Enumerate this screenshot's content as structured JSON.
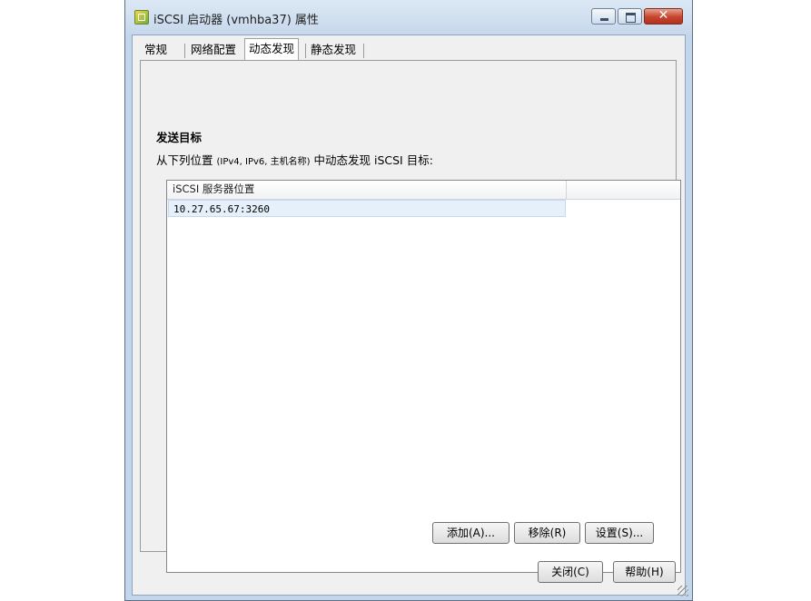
{
  "window": {
    "title": "iSCSI 启动器 (vmhba37) 属性"
  },
  "titlebar_buttons": {
    "minimize": "minimize-icon",
    "maximize": "maximize-icon",
    "close": "✕"
  },
  "tabs": [
    {
      "label": "常规"
    },
    {
      "label": "网络配置"
    },
    {
      "label": "动态发现"
    },
    {
      "label": "静态发现"
    }
  ],
  "active_tab": "动态发现",
  "section": {
    "title": "发送目标",
    "desc_prefix": "从下列位置 ",
    "desc_small": "(IPv4, IPv6, 主机名称)",
    "desc_suffix": " 中动态发现 iSCSI 目标:"
  },
  "list": {
    "columns": [
      "iSCSI 服务器位置",
      ""
    ],
    "rows": [
      "10.27.65.67:3260"
    ]
  },
  "buttons": {
    "add": "添加(A)...",
    "remove": "移除(R)",
    "settings": "设置(S)...",
    "close": "关闭(C)",
    "help": "帮助(H)"
  }
}
